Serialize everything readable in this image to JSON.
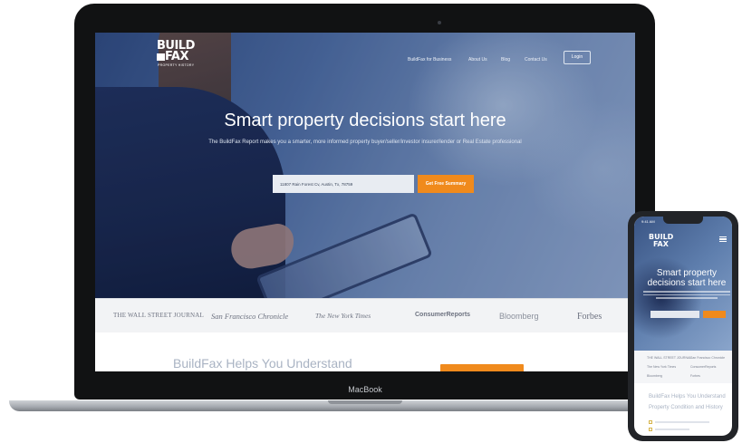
{
  "desktop": {
    "logo": {
      "line1": "BUILD",
      "line2": "FAX",
      "sub": "PROPERTY HISTORY"
    },
    "nav": {
      "items": [
        "BuildFax for Business",
        "About Us",
        "Blog",
        "Contact Us"
      ],
      "login": "Login"
    },
    "hero": {
      "headline": "Smart property decisions start here",
      "subline": "The BuildFax Report makes you a smarter, more informed property buyer/seller/investor insurer/lender or Real Estate professional",
      "search_value": "11807 Rain Forest Cv, Austin, Tx, 78759",
      "cta": "Get Free Summary"
    },
    "press": [
      "THE WALL STREET JOURNAL",
      "San Francisco Chronicle",
      "The New York Times",
      "ConsumerReports",
      "Bloomberg",
      "Forbes"
    ],
    "section_title": "BuildFax Helps You Understand"
  },
  "laptop_label": "MacBook",
  "mobile": {
    "time": "9:41 AM",
    "logo": {
      "line1": "BUILD",
      "line2": "FAX"
    },
    "headline": "Smart property decisions start here",
    "press": [
      "THE WALL STREET JOURNAL",
      "San Francisco Chronicle",
      "The New York Times",
      "ConsumerReports",
      "Bloomberg",
      "Forbes"
    ],
    "section_title_1": "BuildFax Helps You Understand",
    "section_title_2": "Property Condition and History"
  },
  "colors": {
    "accent": "#f08a1c",
    "hero_blue": "#4d6c9f",
    "press_bg": "#f2f3f5"
  }
}
